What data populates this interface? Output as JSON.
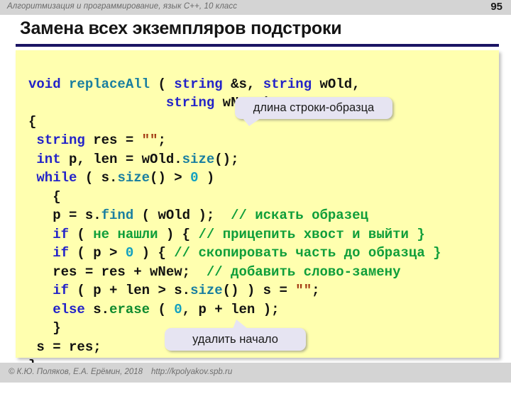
{
  "header": {
    "course_title": "Алгоритмизация и программирование, язык C++, 10 класс",
    "page_number": "95"
  },
  "slide": {
    "title": "Замена всех экземпляров подстроки"
  },
  "code": {
    "language": "C++",
    "lines": [
      {
        "id": "line-1",
        "text": "void replaceAll ( string &s, string wOld,"
      },
      {
        "id": "line-2",
        "text": "                 string wNew )"
      },
      {
        "id": "line-3",
        "text": "{"
      },
      {
        "id": "line-4",
        "text": " string res = \"\";"
      },
      {
        "id": "line-5",
        "text": " int p, len = wOld.size();"
      },
      {
        "id": "line-6",
        "text": " while ( s.size() > 0 )"
      },
      {
        "id": "line-7",
        "text": "   {"
      },
      {
        "id": "line-8",
        "text": "   p = s.find ( wOld );  // искать образец"
      },
      {
        "id": "line-9",
        "text": "   if ( не нашли ) { // прицепить хвост и выйти }"
      },
      {
        "id": "line-10",
        "text": "   if ( p > 0 ) { // скопировать часть до образца }"
      },
      {
        "id": "line-11",
        "text": "   res = res + wNew;  // добавить слово-замену"
      },
      {
        "id": "line-12",
        "text": "   if ( p + len > s.size() ) s = \"\";"
      },
      {
        "id": "line-13",
        "text": "   else s.erase ( 0, p + len );"
      },
      {
        "id": "line-14",
        "text": "   }"
      },
      {
        "id": "line-15",
        "text": " s = res;"
      },
      {
        "id": "line-16",
        "text": "}"
      }
    ]
  },
  "callouts": [
    {
      "id": "pattern-length",
      "text": "длина строки-образца"
    },
    {
      "id": "remove-start",
      "text": "удалить начало"
    }
  ],
  "footer": {
    "copyright": "© К.Ю. Поляков, Е.А. Ерёмин, 2018",
    "url": "http://kpolyakov.spb.ru"
  },
  "colors": {
    "header_band": "#d4d4d4",
    "title_rule": "#1b1464",
    "code_background": "#ffffaf",
    "keyword": "#2323c8",
    "function": "#1a7fa0",
    "number": "#12a0c0",
    "comment": "#0f9e3a",
    "string_literal": "#a33a12",
    "callout_background": "#e6e4f2"
  }
}
